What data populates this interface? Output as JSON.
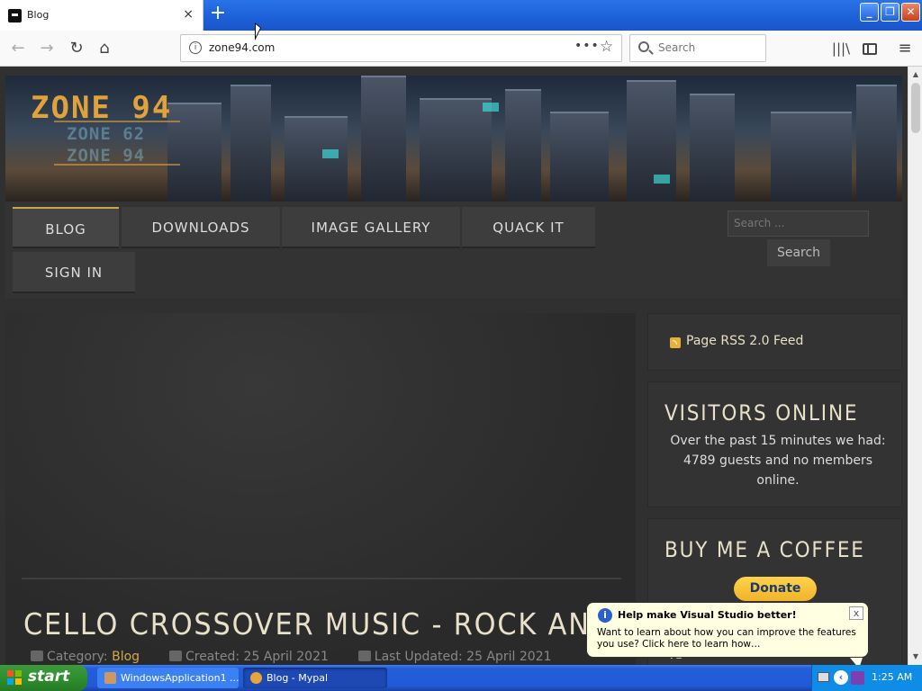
{
  "browser": {
    "tab_title": "Blog",
    "tab_close": "×",
    "new_tab": "+",
    "url": "zone94.com",
    "page_actions": "•••",
    "bookmark_star": "☆",
    "search_placeholder": "Search",
    "win_min": "_",
    "win_max": "❐",
    "win_close": "✕",
    "icons": [
      "back-icon",
      "forward-icon",
      "reload-icon",
      "home-icon",
      "info-icon",
      "star-icon",
      "search-icon",
      "library-icon",
      "sidebar-icon",
      "menu-icon"
    ]
  },
  "site": {
    "logo": "ZONE 94",
    "logo_sub1": "ZONE 62",
    "logo_sub2": "ZONE 94",
    "menu": {
      "blog": "BLOG",
      "downloads": "DOWNLOADS",
      "gallery": "IMAGE GALLERY",
      "quack": "QUACK IT",
      "signin": "SIGN IN"
    },
    "search_placeholder": "Search ...",
    "search_button": "Search"
  },
  "article": {
    "title": "CELLO CROSSOVER MUSIC - ROCK AND MET",
    "category_label": "Category: ",
    "category": "Blog",
    "created": "Created: 25 April 2021",
    "updated": "Last Updated: 25 April 2021"
  },
  "sidebar": {
    "rss": "Page RSS 2.0 Feed",
    "visitors_title": "VISITORS ONLINE",
    "visitors_text": "Over the past 15 minutes we had: 4789 guests and no members online.",
    "coffee_title": "BUY ME A COFFEE",
    "donate": "Donate",
    "coffee_extra": "v1"
  },
  "balloon": {
    "title": "Help make Visual Studio better!",
    "text": "Want to learn about how you can improve the features you use? Click here to learn how…",
    "close": "x",
    "icon": "i"
  },
  "taskbar": {
    "start": "start",
    "items": [
      "WindowsApplication1 ...",
      "Blog - Mypal"
    ],
    "clock": "1:25 AM"
  },
  "colors": {
    "accent_gold": "#d5a84a",
    "page_bg": "#303030",
    "xp_blue": "#245edb",
    "start_green": "#2f8f2f"
  }
}
